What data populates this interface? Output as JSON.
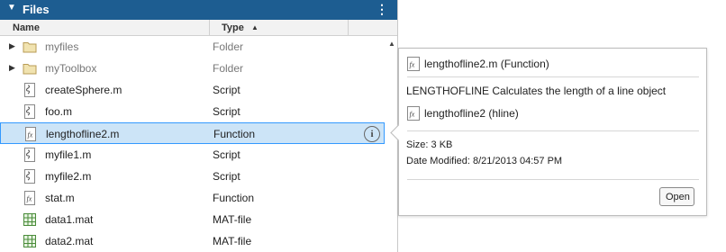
{
  "panel": {
    "title": "Files",
    "columns": {
      "name": "Name",
      "type": "Type"
    },
    "sort_indicator": "▲"
  },
  "rows": [
    {
      "name": "myfiles",
      "type": "Folder",
      "icon": "folder-icon",
      "expandable": true,
      "dim": true
    },
    {
      "name": "myToolbox",
      "type": "Folder",
      "icon": "folder-icon",
      "expandable": true,
      "dim": true
    },
    {
      "name": "createSphere.m",
      "type": "Script",
      "icon": "script-icon"
    },
    {
      "name": "foo.m",
      "type": "Script",
      "icon": "script-icon"
    },
    {
      "name": "lengthofline2.m",
      "type": "Function",
      "icon": "function-icon",
      "selected": true
    },
    {
      "name": "myfile1.m",
      "type": "Script",
      "icon": "script-icon"
    },
    {
      "name": "myfile2.m",
      "type": "Script",
      "icon": "script-icon"
    },
    {
      "name": "stat.m",
      "type": "Function",
      "icon": "function-icon"
    },
    {
      "name": "data1.mat",
      "type": "MAT-file",
      "icon": "mat-file-icon"
    },
    {
      "name": "data2.mat",
      "type": "MAT-file",
      "icon": "mat-file-icon"
    }
  ],
  "popup": {
    "title": "lengthofline2.m (Function)",
    "description": "LENGTHOFLINE Calculates the length of a line object",
    "signature": "lengthofline2 (hline)",
    "size_label": "Size:",
    "size_value": "3 KB",
    "modified_label": "Date Modified:",
    "modified_value": "8/21/2013 04:57 PM",
    "open_button": "Open"
  },
  "colors": {
    "titlebar": "#1d5d91",
    "selection_bg": "#cce4f7",
    "selection_border": "#3399ff"
  }
}
